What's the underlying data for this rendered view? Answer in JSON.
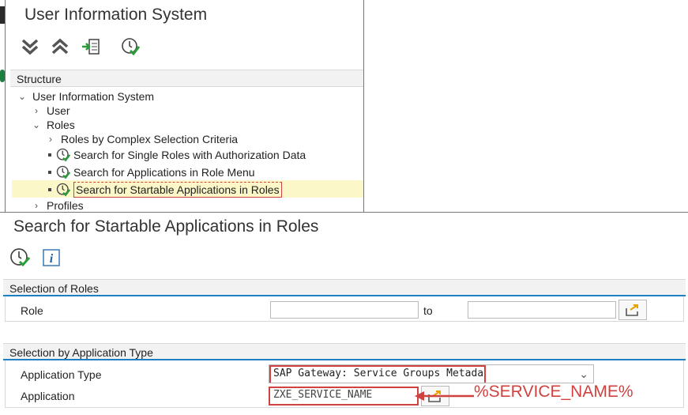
{
  "top_window": {
    "title": "User Information System",
    "toolbar": {
      "expand_icon": "double-chevron-down-icon",
      "collapse_icon": "double-chevron-up-icon",
      "save_icon": "export-icon",
      "execute_icon": "execute-clock-icon"
    },
    "structure_header": "Structure",
    "tree": {
      "root": "User Information System",
      "user": "User",
      "roles": "Roles",
      "roles_complex": "Roles by Complex Selection Criteria",
      "single_roles": "Search for Single Roles with Authorization Data",
      "apps_menu": "Search for Applications in Role Menu",
      "startable_apps": "Search for Startable Applications in Roles",
      "profiles": "Profiles"
    }
  },
  "bottom_window": {
    "title": "Search for Startable Applications in Roles",
    "section_roles": {
      "header": "Selection of Roles",
      "role_label": "Role",
      "to_label": "to",
      "role_from": "",
      "role_to": ""
    },
    "section_app": {
      "header": "Selection by Application Type",
      "app_type_label": "Application Type",
      "app_type_value": "SAP Gateway: Service Groups Metadata",
      "application_label": "Application",
      "application_value": "ZXE_SERVICE_NAME"
    },
    "callout": "%SERVICE_NAME%"
  },
  "colors": {
    "accent": "#1f7fc1",
    "highlight": "#d0423f",
    "selected_row": "#fbf7c8"
  }
}
